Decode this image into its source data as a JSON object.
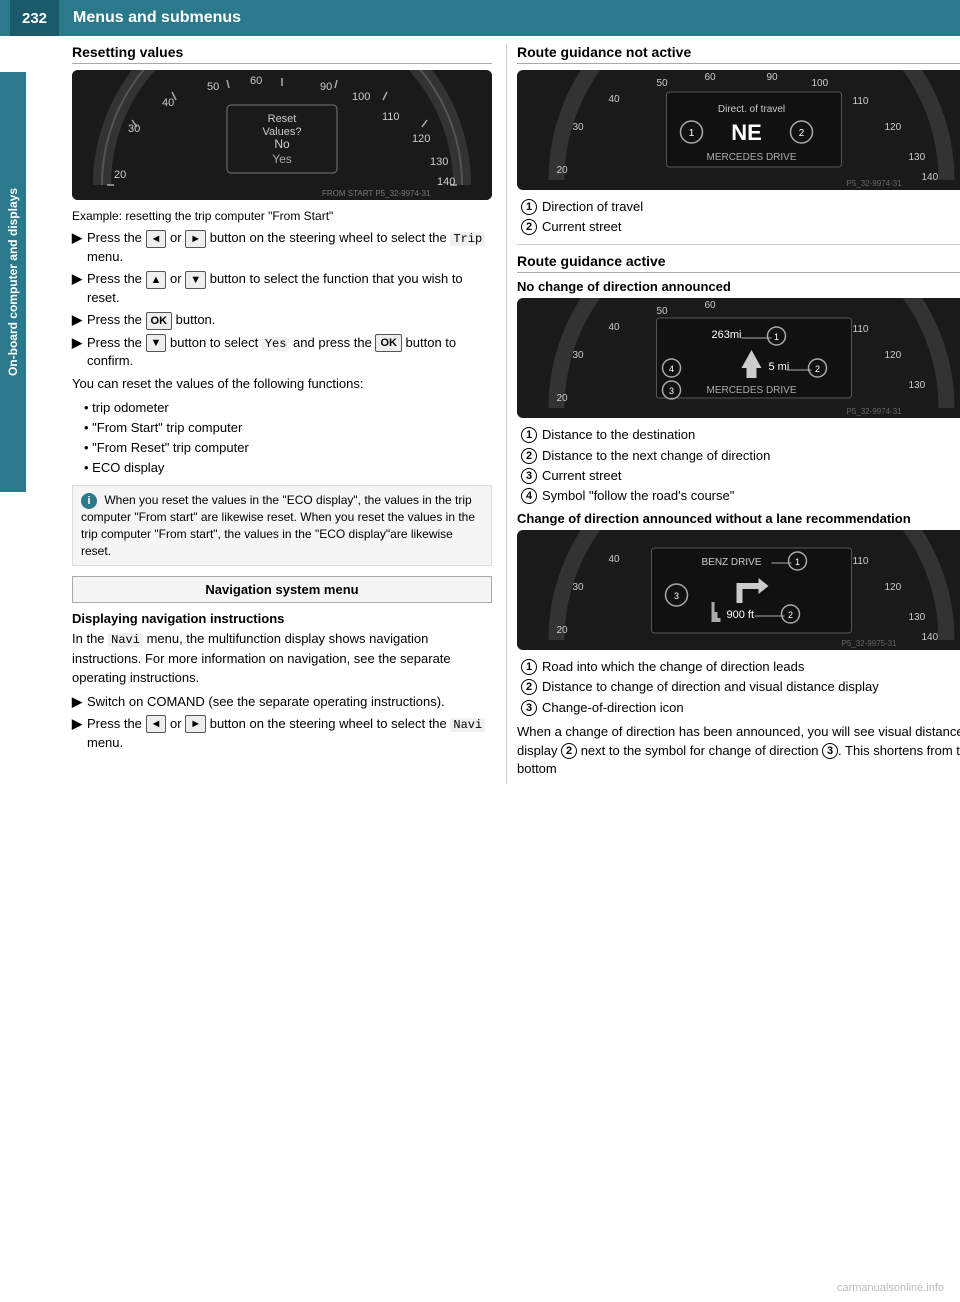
{
  "header": {
    "page_number": "232",
    "title": "Menus and submenus"
  },
  "side_tab": {
    "label": "On-board computer and displays"
  },
  "left_column": {
    "resetting_values": {
      "section_title": "Resetting values",
      "example_text": "Example: resetting the trip computer \"From Start\"",
      "steps": [
        {
          "prefix": "Press the",
          "btn1": "◄",
          "middle": "or",
          "btn2": "►",
          "suffix": "button on the steering wheel to select the",
          "menu": "Trip",
          "end": "menu."
        },
        {
          "prefix": "Press the",
          "btn1": "▲",
          "middle": "or",
          "btn2": "▼",
          "suffix": "button to select the function that you wish to reset."
        },
        {
          "prefix": "Press the",
          "btn1": "OK",
          "suffix": "button."
        },
        {
          "prefix": "Press the",
          "btn1": "▼",
          "suffix": "button to select",
          "menu": "Yes",
          "end": "and press the",
          "btn2": "OK",
          "end2": "button to confirm."
        }
      ],
      "followup": "You can reset the values of the following functions:",
      "bullet_list": [
        "trip odometer",
        "\"From Start\" trip computer",
        "\"From Reset\" trip computer",
        "ECO display"
      ],
      "info_text": "When you reset the values in the \"ECO display\", the values in the trip computer \"From start\" are likewise reset. When you reset the values in the trip computer \"From start\", the values in the \"ECO display\"are likewise reset."
    },
    "nav_menu_box": "Navigation system menu",
    "displaying_nav": {
      "subsection_title": "Displaying navigation instructions",
      "body": "In the",
      "menu_navi": "Navi",
      "body2": "menu, the multifunction display shows navigation instructions. For more information on navigation, see the separate operating instructions.",
      "steps": [
        {
          "prefix": "Switch on COMAND (see the separate operating instructions)."
        },
        {
          "prefix": "Press the",
          "btn1": "◄",
          "middle": "or",
          "btn2": "►",
          "suffix": "button on the steering wheel to select the",
          "menu": "Navi",
          "end": "menu."
        }
      ]
    }
  },
  "right_column": {
    "route_guidance_not_active": {
      "section_title": "Route guidance not active",
      "gauge_labels": {
        "top_text": "Direct. of travel",
        "center_text": "NE",
        "bottom_text": "MERCEDES DRIVE",
        "watermark": "P5_32-9974-31"
      },
      "circle_items": [
        "Direction of travel",
        "Current street"
      ]
    },
    "route_guidance_active": {
      "section_title": "Route guidance active",
      "no_change": {
        "subsection_title": "No change of direction announced",
        "gauge_labels": {
          "dist1": "263mi",
          "dist2": "5 mi",
          "bottom_text": "MERCEDES DRIVE",
          "watermark": "P5_32-9974-31"
        },
        "circle_items": [
          "Distance to the destination",
          "Distance to the next change of direction",
          "Current street",
          "Symbol \"follow the road's course\""
        ]
      },
      "change_announced": {
        "subsection_title": "Change of direction announced without a lane recommendation",
        "gauge_labels": {
          "top_text": "BENZ DRIVE",
          "dist": "900 ft",
          "watermark": "P5_32-9975-31"
        },
        "circle_items": [
          "Road into which the change of direction leads",
          "Distance to change of direction and visual distance display",
          "Change-of-direction icon"
        ]
      }
    },
    "bottom_text": "When a change of direction has been announced, you will see visual distance display ② next to the symbol for change of direction ③. This shortens from the bottom"
  },
  "footer": {
    "url": "carmanualsonline.info"
  }
}
